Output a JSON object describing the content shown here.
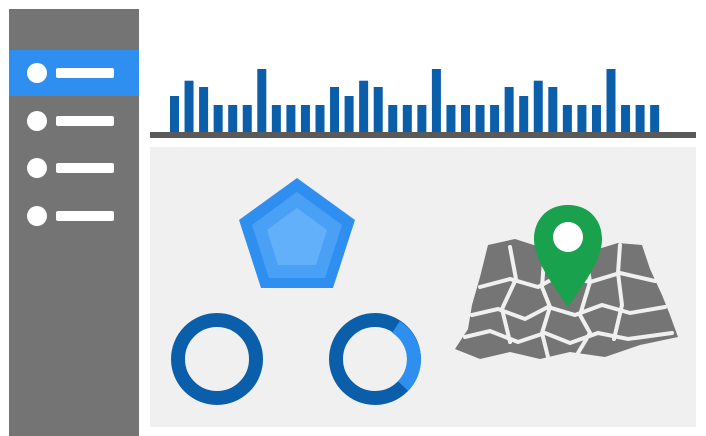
{
  "colors": {
    "sidebar": "#747474",
    "nav_active": "#2f8ff0",
    "bar": "#0b5faa",
    "baseline": "#5a5a5a",
    "panel": "#f0f0f0",
    "pentagon_outer": "#2f8ff0",
    "pentagon_mid": "#4aa0f5",
    "pentagon_inner": "#63b0fa",
    "ring_dark": "#0b5faa",
    "ring_light": "#2f8ff0",
    "map": "#757575",
    "pin": "#1aa14d"
  },
  "sidebar": {
    "items": [
      {
        "active": true,
        "icon": "list-item-icon"
      },
      {
        "active": false,
        "icon": "list-item-icon"
      },
      {
        "active": false,
        "icon": "list-item-icon"
      },
      {
        "active": false,
        "icon": "list-item-icon"
      }
    ]
  },
  "chart_data": {
    "type": "bar",
    "values": [
      40,
      57,
      50,
      30,
      30,
      30,
      70,
      30,
      30,
      30,
      30,
      50,
      40,
      57,
      50,
      30,
      30,
      30,
      70,
      30,
      30,
      30,
      30,
      50,
      40,
      57,
      50,
      30,
      30,
      30,
      70,
      30,
      30,
      30
    ],
    "ylim": [
      0,
      80
    ],
    "title": "",
    "xlabel": "",
    "ylabel": ""
  },
  "widgets": {
    "pentagon_icon": "pentagon-icon",
    "rings": [
      {
        "name": "ring-full",
        "fill": 1.0
      },
      {
        "name": "ring-partial",
        "fill": 0.3
      }
    ],
    "map_icon": "map-icon",
    "pin_icon": "map-pin-icon"
  }
}
